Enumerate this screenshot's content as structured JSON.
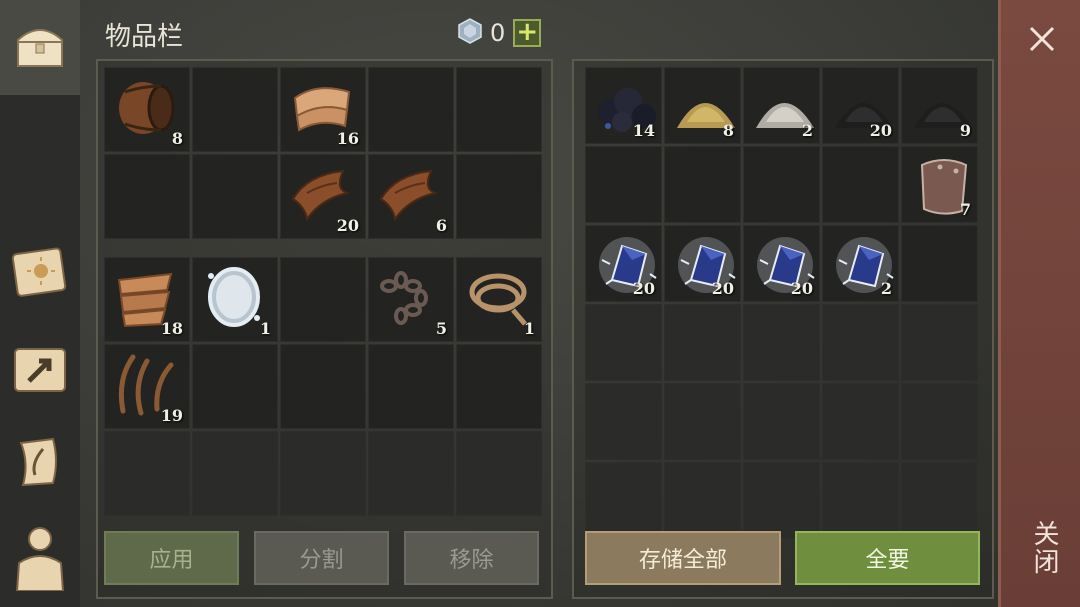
{
  "header": {
    "title": "物品栏",
    "currency_count": "0",
    "add_label": "+"
  },
  "sidebar": {
    "tabs": [
      "chest-icon",
      "sun-map-icon",
      "arrow-map-icon",
      "scroll-quill-icon",
      "character-icon"
    ]
  },
  "inventory_top": [
    {
      "item": "barrel",
      "qty": "8"
    },
    {
      "item": "",
      "qty": ""
    },
    {
      "item": "cloth",
      "qty": "16"
    },
    {
      "item": "",
      "qty": ""
    },
    {
      "item": "",
      "qty": ""
    },
    {
      "item": "",
      "qty": ""
    },
    {
      "item": "",
      "qty": ""
    },
    {
      "item": "leather",
      "qty": "20"
    },
    {
      "item": "leather",
      "qty": "6"
    },
    {
      "item": "",
      "qty": ""
    }
  ],
  "inventory_bottom": [
    {
      "item": "rags",
      "qty": "18"
    },
    {
      "item": "mirror",
      "qty": "1"
    },
    {
      "item": "",
      "qty": ""
    },
    {
      "item": "chain",
      "qty": "5"
    },
    {
      "item": "rope",
      "qty": "1"
    },
    {
      "item": "fiber",
      "qty": "19"
    },
    {
      "item": "",
      "qty": ""
    },
    {
      "item": "",
      "qty": ""
    },
    {
      "item": "",
      "qty": ""
    },
    {
      "item": "",
      "qty": ""
    },
    {
      "item": "",
      "qty": ""
    },
    {
      "item": "",
      "qty": ""
    },
    {
      "item": "",
      "qty": ""
    },
    {
      "item": "",
      "qty": ""
    },
    {
      "item": "",
      "qty": ""
    }
  ],
  "storage": [
    {
      "item": "coal",
      "qty": "14"
    },
    {
      "item": "sulfur",
      "qty": "8"
    },
    {
      "item": "salt",
      "qty": "2"
    },
    {
      "item": "gunpowder",
      "qty": "20"
    },
    {
      "item": "gunpowder",
      "qty": "9"
    },
    {
      "item": "",
      "qty": ""
    },
    {
      "item": "",
      "qty": ""
    },
    {
      "item": "",
      "qty": ""
    },
    {
      "item": "",
      "qty": ""
    },
    {
      "item": "plate",
      "qty": "7"
    },
    {
      "item": "crystal",
      "qty": "20"
    },
    {
      "item": "crystal",
      "qty": "20"
    },
    {
      "item": "crystal",
      "qty": "20"
    },
    {
      "item": "crystal",
      "qty": "2"
    },
    {
      "item": "",
      "qty": ""
    },
    {
      "item": "",
      "qty": ""
    },
    {
      "item": "",
      "qty": ""
    },
    {
      "item": "",
      "qty": ""
    },
    {
      "item": "",
      "qty": ""
    },
    {
      "item": "",
      "qty": ""
    },
    {
      "item": "",
      "qty": ""
    },
    {
      "item": "",
      "qty": ""
    },
    {
      "item": "",
      "qty": ""
    },
    {
      "item": "",
      "qty": ""
    },
    {
      "item": "",
      "qty": ""
    },
    {
      "item": "",
      "qty": ""
    },
    {
      "item": "",
      "qty": ""
    },
    {
      "item": "",
      "qty": ""
    },
    {
      "item": "",
      "qty": ""
    },
    {
      "item": "",
      "qty": ""
    }
  ],
  "buttons": {
    "apply": "应用",
    "split": "分割",
    "remove": "移除",
    "store_all": "存储全部",
    "take_all": "全要"
  },
  "close": {
    "label": "关闭"
  },
  "colors": {
    "accent_green": "#6f8e3e",
    "close_red": "#7a4a40",
    "slot": "#232422"
  }
}
